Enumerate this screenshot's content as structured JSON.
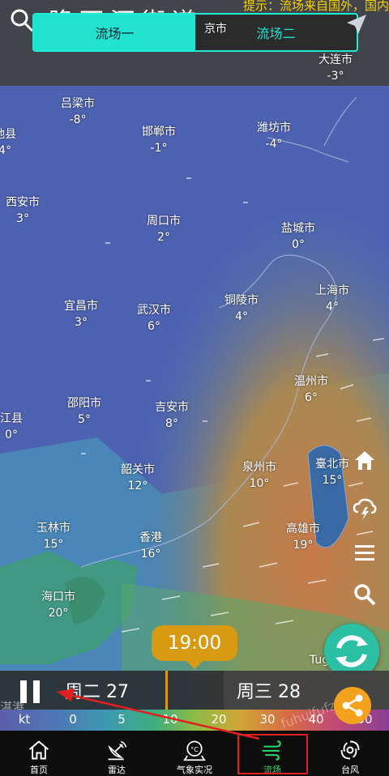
{
  "header": {
    "title_partial": "隆西河街道",
    "hint": "提示：流场来自国外，国内",
    "tabs": [
      {
        "label": "流场一",
        "active": true
      },
      {
        "label": "流场二",
        "active": false
      }
    ]
  },
  "cities": [
    {
      "name": "吕梁市",
      "temp": "-8°"
    },
    {
      "name": "邯郸市",
      "temp": "-1°"
    },
    {
      "name": "潍坊市",
      "temp": "-4°"
    },
    {
      "name": "大连市",
      "temp": "-3°"
    },
    {
      "name": "地县",
      "temp": "4°"
    },
    {
      "name": "西安市",
      "temp": "3°"
    },
    {
      "name": "周口市",
      "temp": "2°"
    },
    {
      "name": "盐城市",
      "temp": "0°"
    },
    {
      "name": "宜昌市",
      "temp": "3°"
    },
    {
      "name": "武汉市",
      "temp": "6°"
    },
    {
      "name": "铜陵市",
      "temp": "4°"
    },
    {
      "name": "上海市",
      "temp": "4°"
    },
    {
      "name": "温州市",
      "temp": "6°"
    },
    {
      "name": "邵阳市",
      "temp": "5°"
    },
    {
      "name": "吉安市",
      "temp": "8°"
    },
    {
      "name": "江县",
      "temp": "0°"
    },
    {
      "name": "韶关市",
      "temp": "12°"
    },
    {
      "name": "泉州市",
      "temp": "10°"
    },
    {
      "name": "臺北市",
      "temp": "15°"
    },
    {
      "name": "玉林市",
      "temp": "15°"
    },
    {
      "name": "香港",
      "temp": "16°"
    },
    {
      "name": "高雄市",
      "temp": "19°"
    },
    {
      "name": "海口市",
      "temp": "20°"
    },
    {
      "name": "Tug",
      "temp": ""
    },
    {
      "name": "京市",
      "temp": ""
    }
  ],
  "time": {
    "current": "19:00",
    "day1": "周二 27",
    "day2": "周三 28",
    "left_fragment": "湛港"
  },
  "scale": {
    "unit": "kt",
    "ticks": [
      "0",
      "5",
      "10",
      "20",
      "30",
      "40",
      "50"
    ]
  },
  "watermark": "fuhuifufz.com",
  "nav": [
    {
      "label": "首页",
      "icon": "home-icon",
      "active": false
    },
    {
      "label": "雷达",
      "icon": "radar-icon",
      "active": false
    },
    {
      "label": "气象实况",
      "icon": "thermometer-icon",
      "active": false
    },
    {
      "label": "流场",
      "icon": "wind-icon",
      "active": true
    },
    {
      "label": "台风",
      "icon": "typhoon-icon",
      "active": false
    }
  ],
  "colors": {
    "accent": "#21e3cf",
    "active_nav": "#2fd66e",
    "time_bubble": "#d89a12",
    "hint": "#f6d200",
    "highlight": "#e02020"
  }
}
